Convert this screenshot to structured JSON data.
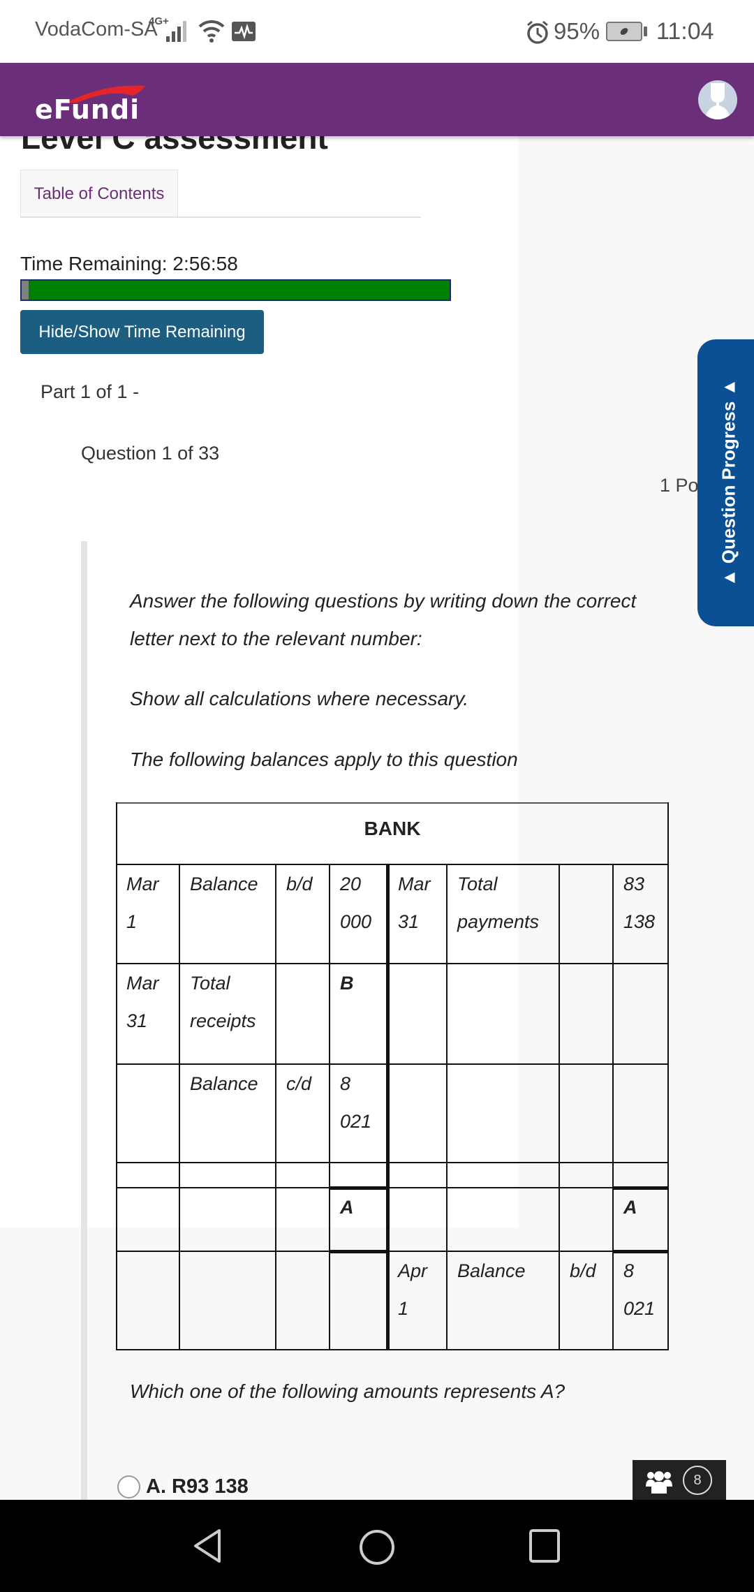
{
  "status_bar": {
    "carrier": "VodaCom-SA",
    "network_type": "4G+",
    "battery_percent": "95%",
    "time": "11:04"
  },
  "header": {
    "logo_text": "eFundi",
    "avatar_icon": "user-avatar-icon"
  },
  "page": {
    "title": "Level C assessment",
    "tabs": [
      {
        "label": "Table of Contents"
      }
    ],
    "time_remaining_label": "Time Remaining: 2:56:58",
    "time_bar": {
      "remaining_fraction": 0.984,
      "used_color": "#808080",
      "remaining_color": "#008000"
    },
    "toggle_time_button": "Hide/Show Time Remaining",
    "part_label": "Part 1 of 1 -",
    "question_label": "Question 1 of 33",
    "points_label": "1 Po",
    "question_progress_tab": "▲ Question Progress ▲"
  },
  "question": {
    "intro": [
      "Answer the following questions by writing down the correct",
      "letter next to the relevant number:",
      "Show all calculations where necessary.",
      "The following balances apply to this question"
    ],
    "ledger": {
      "title": "BANK",
      "rows": [
        {
          "debit": [
            "Mar\n1",
            "Balance",
            "b/d",
            "20\n000"
          ],
          "credit": [
            "Mar\n31",
            "Total\npayments",
            "",
            "83\n138"
          ]
        },
        {
          "debit": [
            "Mar\n31",
            "Total\nreceipts",
            "",
            "B"
          ],
          "credit": [
            "",
            "",
            "",
            ""
          ]
        },
        {
          "debit": [
            "",
            "Balance",
            "c/d",
            "8\n021"
          ],
          "credit": [
            "",
            "",
            "",
            ""
          ]
        },
        {
          "debit": [
            "",
            "",
            "",
            ""
          ],
          "credit": [
            "",
            "",
            "",
            ""
          ]
        },
        {
          "debit": [
            "",
            "",
            "",
            "A"
          ],
          "credit": [
            "",
            "",
            "",
            "A"
          ]
        },
        {
          "debit": [
            "",
            "",
            "",
            ""
          ],
          "credit": [
            "Apr\n1",
            "Balance",
            "b/d",
            "8\n021"
          ]
        }
      ]
    },
    "stem": "Which one of the following amounts represents A?",
    "options": [
      {
        "label": "A. R93 138",
        "selected": false
      }
    ]
  },
  "chat_widget": {
    "icon": "users-icon",
    "count": "8"
  },
  "nav_bar": {
    "buttons": [
      "back",
      "home",
      "recents"
    ]
  },
  "colors": {
    "header_purple": "#6b2f7a",
    "button_blue": "#1b5e82",
    "progress_tab_blue": "#0b4f94",
    "timer_green": "#008000"
  }
}
